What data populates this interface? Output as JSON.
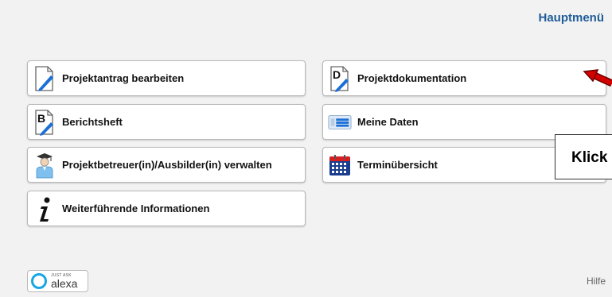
{
  "header": {
    "title": "Hauptmenü"
  },
  "menu": {
    "left": [
      {
        "label": "Projektantrag bearbeiten",
        "icon": "pencil-document-icon"
      },
      {
        "label": "Berichtsheft",
        "icon": "letter-b-document-icon"
      },
      {
        "label": "Projektbetreuer(in)/Ausbilder(in) verwalten",
        "icon": "graduate-person-icon"
      },
      {
        "label": "Weiterführende Informationen",
        "icon": "info-icon"
      }
    ],
    "right": [
      {
        "label": "Projektdokumentation",
        "icon": "letter-d-document-icon"
      },
      {
        "label": "Meine Daten",
        "icon": "id-card-icon"
      },
      {
        "label": "Terminübersicht",
        "icon": "calendar-icon"
      }
    ]
  },
  "annotation": {
    "callout_text": "Klick"
  },
  "footer": {
    "alexa_small": "JUST ASK",
    "alexa_big": "alexa",
    "help_label": "Hilfe"
  },
  "colors": {
    "accent": "#1f5c99",
    "pencil": "#1a6fd6",
    "arrow": "#d40000",
    "calendar": "#1b3d8f"
  }
}
